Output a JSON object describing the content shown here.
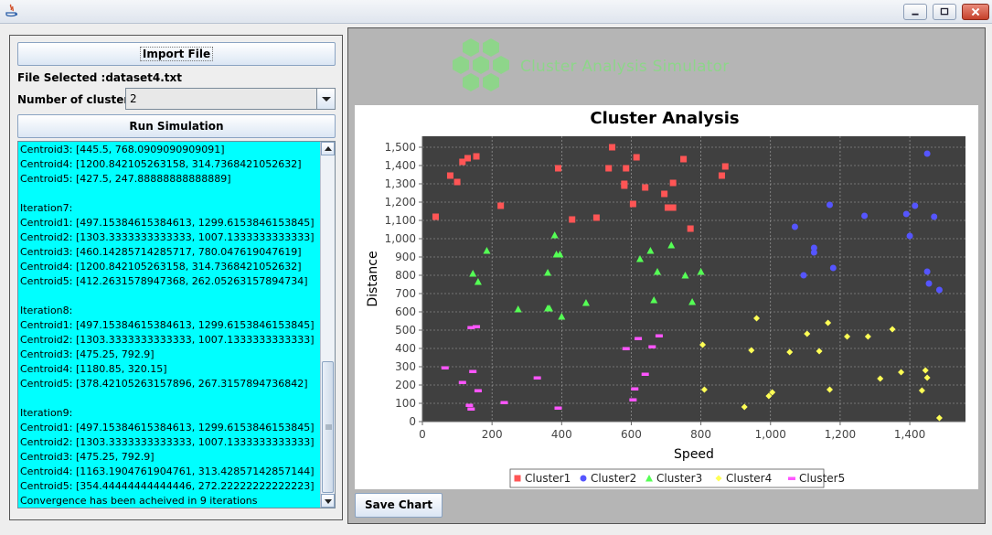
{
  "window": {
    "controls": [
      "minimize",
      "maximize",
      "close"
    ]
  },
  "left_panel": {
    "import_button": "Import File",
    "file_selected": "File Selected :dataset4.txt",
    "clusters_label": "Number of clusters:",
    "clusters_value": "2",
    "run_button": "Run Simulation",
    "log": [
      "Centroid3: [445.5, 768.0909090909091]",
      "Centroid4: [1200.842105263158, 314.7368421052632]",
      "Centroid5: [427.5, 247.88888888888889]",
      "",
      "Iteration7:",
      "Centroid1: [497.15384615384613, 1299.6153846153845]",
      "Centroid2: [1303.3333333333333, 1007.1333333333333]",
      "Centroid3: [460.14285714285717, 780.047619047619]",
      "Centroid4: [1200.842105263158, 314.7368421052632]",
      "Centroid5: [412.2631578947368, 262.05263157894734]",
      "",
      "Iteration8:",
      "Centroid1: [497.15384615384613, 1299.6153846153845]",
      "Centroid2: [1303.3333333333333, 1007.1333333333333]",
      "Centroid3: [475.25, 792.9]",
      "Centroid4: [1180.85, 320.15]",
      "Centroid5: [378.42105263157896, 267.3157894736842]",
      "",
      "Iteration9:",
      "Centroid1: [497.15384615384613, 1299.6153846153845]",
      "Centroid2: [1303.3333333333333, 1007.1333333333333]",
      "Centroid3: [475.25, 792.9]",
      "Centroid4: [1163.1904761904761, 313.42857142857144]",
      "Centroid5: [354.44444444444446, 272.22222222222223]",
      "Convergence has been acheived in 9 iterations"
    ]
  },
  "right_panel": {
    "logo_text": "Cluster Analysis Simulator",
    "save_button": "Save Chart"
  },
  "colors": {
    "log_background": "#00ffff",
    "plot_background": "#404040",
    "cluster1": "#ff5555",
    "cluster2": "#5555ff",
    "cluster3": "#55ff55",
    "cluster4": "#ffff55",
    "cluster5": "#ff55ff",
    "logo_green": "#8ed58a"
  },
  "chart_data": {
    "type": "scatter",
    "title": "Cluster Analysis",
    "xlabel": "Speed",
    "ylabel": "Distance",
    "xlim": [
      0,
      1560
    ],
    "ylim": [
      0,
      1560
    ],
    "xticks": [
      "0",
      "200",
      "400",
      "600",
      "800",
      "1,000",
      "1,200",
      "1,400"
    ],
    "yticks": [
      "0",
      "100",
      "200",
      "300",
      "400",
      "500",
      "600",
      "700",
      "800",
      "900",
      "1,000",
      "1,100",
      "1,200",
      "1,300",
      "1,400",
      "1,500"
    ],
    "grid": true,
    "legend_position": "bottom",
    "series": [
      {
        "name": "Cluster1",
        "marker": "square",
        "color": "#ff5555",
        "points": [
          [
            38,
            1120
          ],
          [
            80,
            1345
          ],
          [
            100,
            1310
          ],
          [
            115,
            1420
          ],
          [
            130,
            1440
          ],
          [
            155,
            1450
          ],
          [
            225,
            1180
          ],
          [
            390,
            1385
          ],
          [
            430,
            1105
          ],
          [
            500,
            1115
          ],
          [
            535,
            1385
          ],
          [
            545,
            1500
          ],
          [
            580,
            1300
          ],
          [
            585,
            1385
          ],
          [
            580,
            1290
          ],
          [
            605,
            1190
          ],
          [
            615,
            1445
          ],
          [
            640,
            1280
          ],
          [
            695,
            1245
          ],
          [
            705,
            1170
          ],
          [
            720,
            1305
          ],
          [
            720,
            1170
          ],
          [
            750,
            1435
          ],
          [
            770,
            1055
          ],
          [
            860,
            1345
          ],
          [
            870,
            1395
          ]
        ]
      },
      {
        "name": "Cluster2",
        "marker": "circle",
        "color": "#5555ff",
        "points": [
          [
            1070,
            1065
          ],
          [
            1095,
            800
          ],
          [
            1125,
            950
          ],
          [
            1125,
            925
          ],
          [
            1170,
            1185
          ],
          [
            1180,
            840
          ],
          [
            1270,
            1125
          ],
          [
            1390,
            1135
          ],
          [
            1400,
            1015
          ],
          [
            1415,
            1180
          ],
          [
            1450,
            1465
          ],
          [
            1450,
            820
          ],
          [
            1455,
            755
          ],
          [
            1470,
            1120
          ],
          [
            1485,
            720
          ]
        ]
      },
      {
        "name": "Cluster3",
        "marker": "triangle",
        "color": "#55ff55",
        "points": [
          [
            145,
            810
          ],
          [
            160,
            765
          ],
          [
            185,
            935
          ],
          [
            275,
            615
          ],
          [
            360,
            620
          ],
          [
            365,
            620
          ],
          [
            360,
            815
          ],
          [
            380,
            1020
          ],
          [
            385,
            915
          ],
          [
            395,
            915
          ],
          [
            400,
            575
          ],
          [
            470,
            650
          ],
          [
            625,
            890
          ],
          [
            655,
            935
          ],
          [
            665,
            665
          ],
          [
            675,
            820
          ],
          [
            715,
            965
          ],
          [
            755,
            800
          ],
          [
            775,
            655
          ],
          [
            800,
            820
          ]
        ]
      },
      {
        "name": "Cluster4",
        "marker": "diamond",
        "color": "#ffff55",
        "points": [
          [
            805,
            420
          ],
          [
            810,
            175
          ],
          [
            925,
            80
          ],
          [
            945,
            390
          ],
          [
            960,
            565
          ],
          [
            995,
            140
          ],
          [
            1005,
            160
          ],
          [
            1055,
            380
          ],
          [
            1105,
            480
          ],
          [
            1140,
            385
          ],
          [
            1165,
            540
          ],
          [
            1170,
            175
          ],
          [
            1220,
            465
          ],
          [
            1280,
            465
          ],
          [
            1315,
            235
          ],
          [
            1350,
            505
          ],
          [
            1375,
            270
          ],
          [
            1435,
            170
          ],
          [
            1445,
            280
          ],
          [
            1450,
            240
          ],
          [
            1485,
            20
          ]
        ]
      },
      {
        "name": "Cluster5",
        "marker": "dash",
        "color": "#ff55ff",
        "points": [
          [
            65,
            295
          ],
          [
            115,
            215
          ],
          [
            135,
            90
          ],
          [
            140,
            70
          ],
          [
            140,
            515
          ],
          [
            145,
            275
          ],
          [
            155,
            520
          ],
          [
            160,
            170
          ],
          [
            235,
            105
          ],
          [
            330,
            240
          ],
          [
            390,
            75
          ],
          [
            585,
            400
          ],
          [
            605,
            120
          ],
          [
            610,
            180
          ],
          [
            620,
            455
          ],
          [
            640,
            260
          ],
          [
            660,
            410
          ],
          [
            680,
            470
          ]
        ]
      }
    ]
  }
}
